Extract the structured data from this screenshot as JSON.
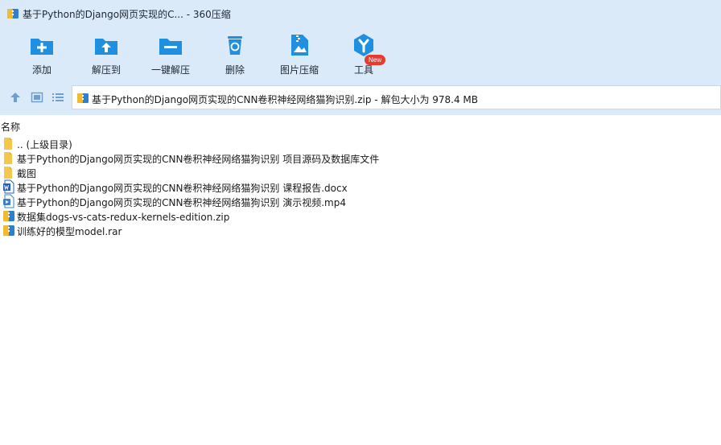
{
  "window": {
    "title": "基于Python的Django网页实现的C... - 360压缩"
  },
  "toolbar": {
    "buttons": [
      {
        "label": "添加",
        "icon": "folder-add-icon"
      },
      {
        "label": "解压到",
        "icon": "folder-extract-icon"
      },
      {
        "label": "一键解压",
        "icon": "folder-oneclick-extract-icon"
      },
      {
        "label": "删除",
        "icon": "trash-icon"
      },
      {
        "label": "图片压缩",
        "icon": "image-compress-icon"
      },
      {
        "label": "工具",
        "icon": "tools-icon",
        "badge": "New"
      }
    ]
  },
  "nav": {
    "path": "基于Python的Django网页实现的CNN卷积神经网络猫狗识别.zip - 解包大小为 978.4 MB"
  },
  "list": {
    "column_header": "名称",
    "rows": [
      {
        "name": ".. (上级目录)",
        "icon": "folder-icon"
      },
      {
        "name": "基于Python的Django网页实现的CNN卷积神经网络猫狗识别 项目源码及数据库文件",
        "icon": "folder-icon"
      },
      {
        "name": "截图",
        "icon": "folder-icon"
      },
      {
        "name": "基于Python的Django网页实现的CNN卷积神经网络猫狗识别 课程报告.docx",
        "icon": "word-doc-icon"
      },
      {
        "name": "基于Python的Django网页实现的CNN卷积神经网络猫狗识别 演示视频.mp4",
        "icon": "video-file-icon"
      },
      {
        "name": "数据集dogs-vs-cats-redux-kernels-edition.zip",
        "icon": "zip-archive-icon"
      },
      {
        "name": "训练好的模型model.rar",
        "icon": "rar-archive-icon"
      }
    ]
  },
  "colors": {
    "accent": "#1e8fe1",
    "chrome": "#dbeaf8",
    "folder": "#f5c74a",
    "badge": "#e53b30"
  }
}
